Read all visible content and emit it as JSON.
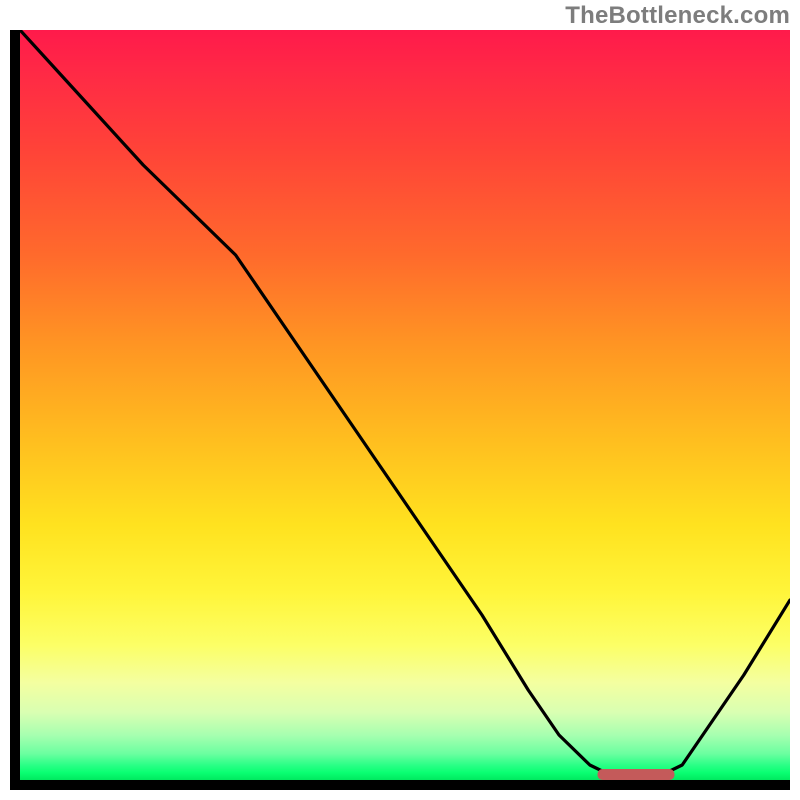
{
  "watermark": "TheBottleneck.com",
  "colors": {
    "axis": "#000000",
    "curve": "#000000",
    "marker": "#c45a5a",
    "gradient_top": "#ff1a4b",
    "gradient_mid": "#ffe21f",
    "gradient_bottom": "#00e85f"
  },
  "chart_data": {
    "type": "line",
    "title": "",
    "xlabel": "",
    "ylabel": "",
    "xlim": [
      0,
      100
    ],
    "ylim": [
      0,
      100
    ],
    "x": [
      0,
      8,
      16,
      24,
      28,
      36,
      44,
      52,
      60,
      66,
      70,
      74,
      78,
      82,
      86,
      90,
      94,
      100
    ],
    "values": [
      100,
      91,
      82,
      74,
      70,
      58,
      46,
      34,
      22,
      12,
      6,
      2,
      0,
      0,
      2,
      8,
      14,
      24
    ],
    "marker": {
      "x_start": 75,
      "x_end": 85,
      "y": 0
    },
    "note": "x/y in percent of plot area; y=0 is bottom (green), y=100 is top (red)."
  }
}
